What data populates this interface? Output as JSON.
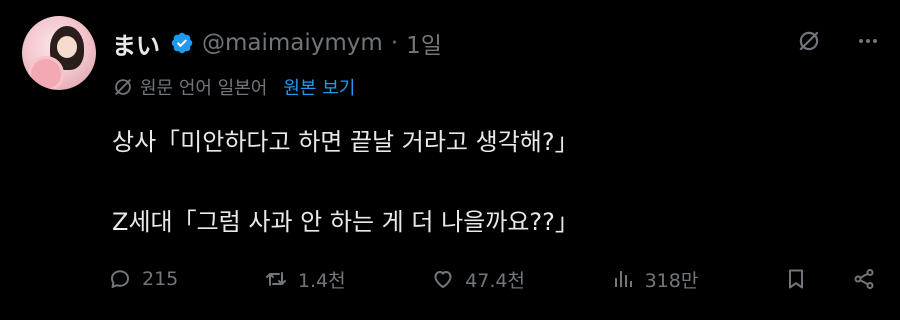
{
  "author": {
    "display_name": "まい",
    "handle": "@maimaiymym",
    "separator": "·",
    "time_ago": "1일",
    "verified": true
  },
  "translation": {
    "note": "원문 언어 일본어",
    "show_original_label": "원본 보기"
  },
  "tweet": {
    "lines": [
      "상사「미안하다고 하면 끝날 거라고 생각해?」",
      "",
      "Z세대「그럼 사과 안 하는 게 더 나을까요??」"
    ]
  },
  "metrics": {
    "replies": "215",
    "reposts": "1.4천",
    "likes": "47.4천",
    "views": "318만"
  },
  "icons": {
    "verified": "verified-badge-icon",
    "grok": "grok-icon",
    "more": "more-icon",
    "translate": "translate-icon",
    "reply": "reply-icon",
    "repost": "repost-icon",
    "like": "heart-icon",
    "views": "views-icon",
    "bookmark": "bookmark-icon",
    "share": "share-icon"
  },
  "colors": {
    "background": "#000000",
    "text": "#e7e9ea",
    "muted": "#71767b",
    "accent": "#1d9bf0"
  }
}
